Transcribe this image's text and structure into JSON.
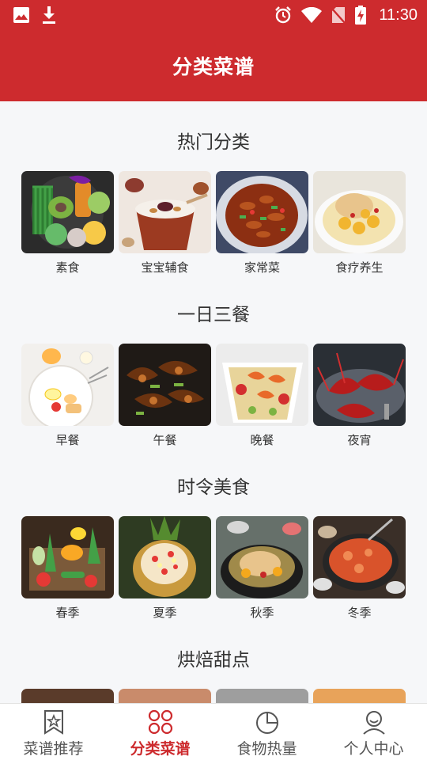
{
  "status_bar": {
    "time": "11:30",
    "icons": [
      "image-icon",
      "download-icon",
      "alarm-icon",
      "wifi-icon",
      "no-sim-icon",
      "battery-charging-icon"
    ]
  },
  "header": {
    "title": "分类菜谱"
  },
  "sections": [
    {
      "title": "热门分类",
      "items": [
        {
          "label": "素食",
          "image": "vegetable-bowl"
        },
        {
          "label": "宝宝辅食",
          "image": "porridge-bowl"
        },
        {
          "label": "家常菜",
          "image": "stir-fry-plate"
        },
        {
          "label": "食疗养生",
          "image": "chicken-soup"
        }
      ]
    },
    {
      "title": "一日三餐",
      "items": [
        {
          "label": "早餐",
          "image": "breakfast-plate"
        },
        {
          "label": "午餐",
          "image": "braised-dish"
        },
        {
          "label": "晚餐",
          "image": "shrimp-salad"
        },
        {
          "label": "夜宵",
          "image": "crayfish"
        }
      ]
    },
    {
      "title": "时令美食",
      "items": [
        {
          "label": "春季",
          "image": "spring-vegetables"
        },
        {
          "label": "夏季",
          "image": "pineapple-rice"
        },
        {
          "label": "秋季",
          "image": "autumn-stew"
        },
        {
          "label": "冬季",
          "image": "hot-pot"
        }
      ]
    },
    {
      "title": "烘焙甜点",
      "items": []
    }
  ],
  "bottom_nav": [
    {
      "label": "菜谱推荐",
      "icon": "bookmark-star-icon",
      "active": false
    },
    {
      "label": "分类菜谱",
      "icon": "grid-icon",
      "active": true
    },
    {
      "label": "食物热量",
      "icon": "pie-chart-icon",
      "active": false
    },
    {
      "label": "个人中心",
      "icon": "user-icon",
      "active": false
    }
  ],
  "colors": {
    "primary": "#cd2b2e",
    "background": "#f6f7f9",
    "nav_inactive": "#555555"
  }
}
